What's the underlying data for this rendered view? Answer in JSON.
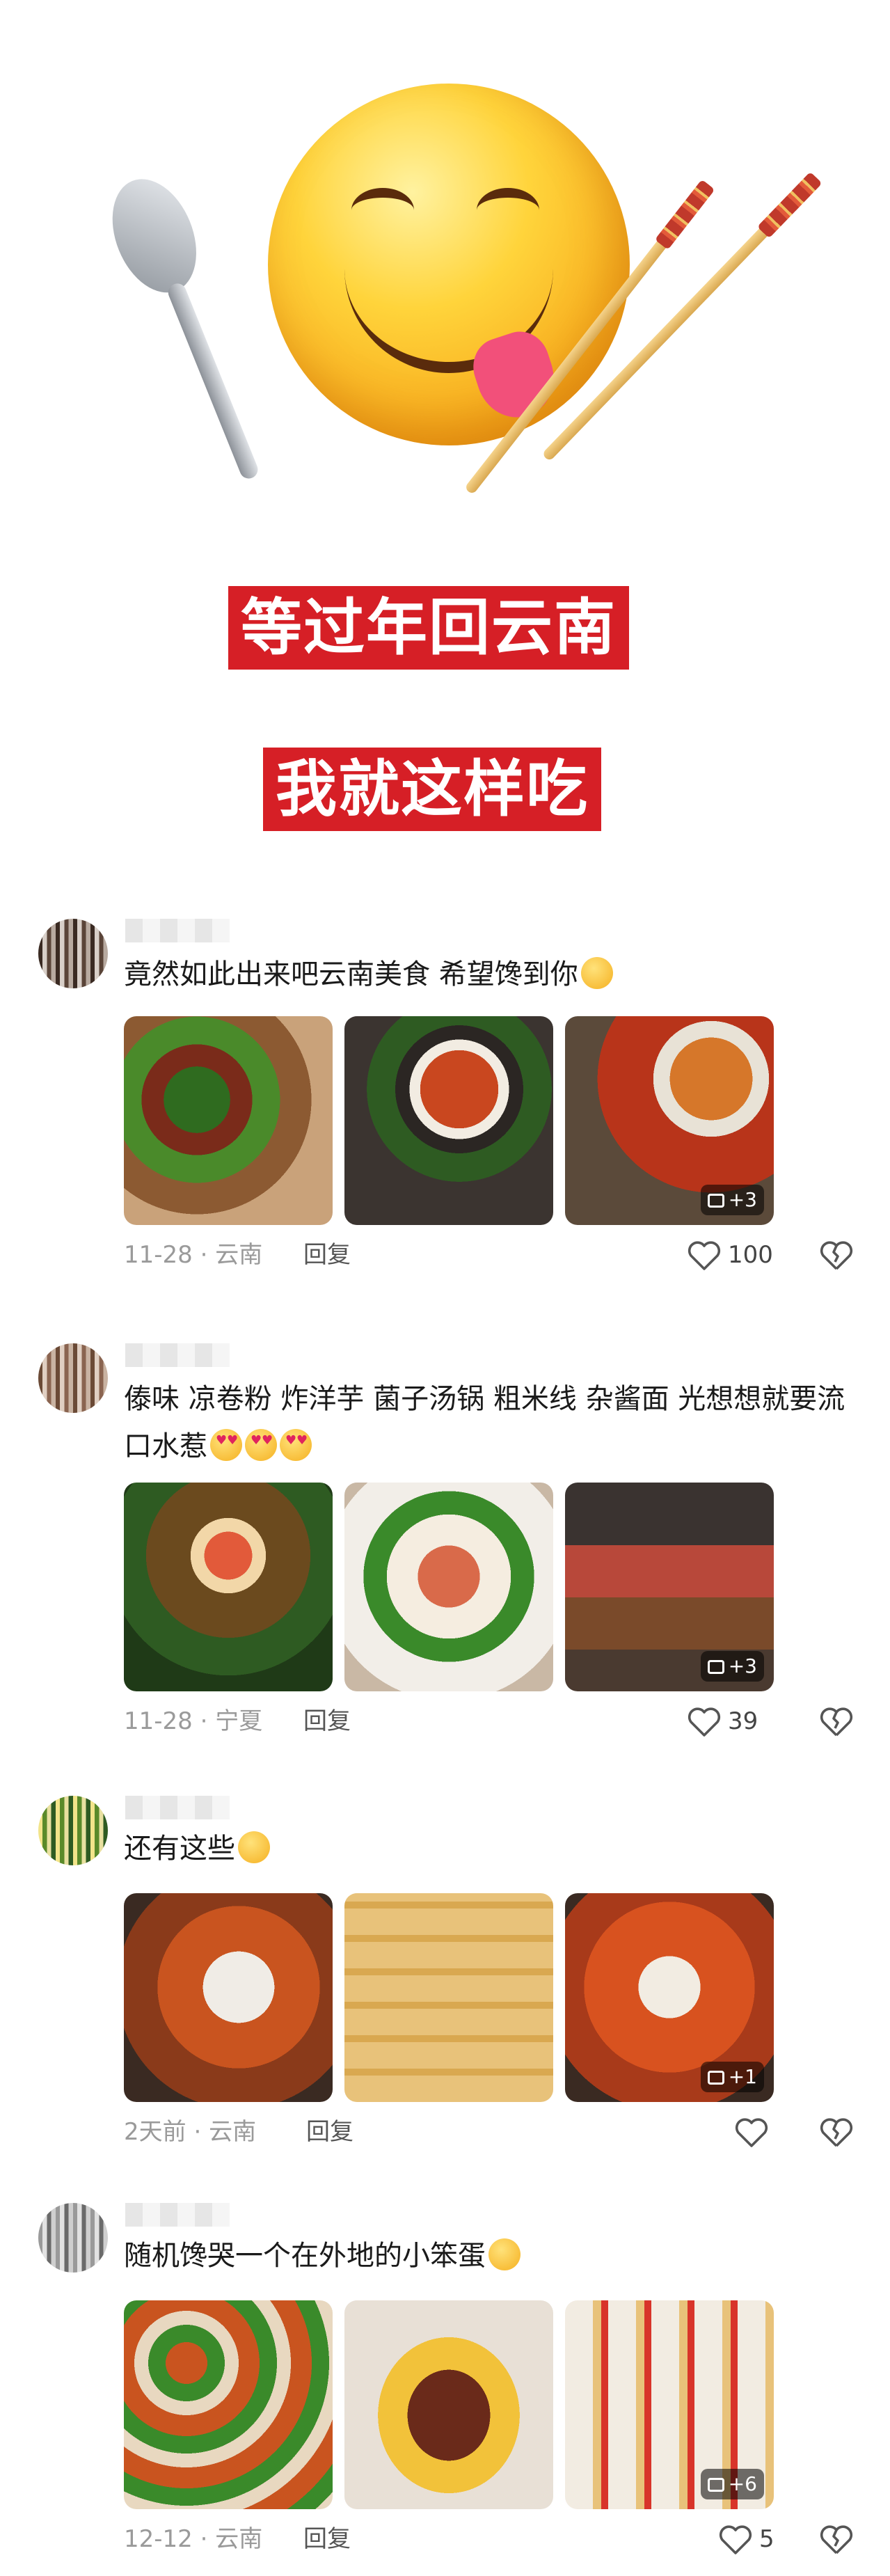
{
  "banner": {
    "line1": "等过年回云南",
    "line2": "我就这样吃"
  },
  "comments": [
    {
      "text": "竟然如此出来吧云南美食 希望馋到你",
      "emoji": "drooling-face-emoji",
      "time": "11-28",
      "location": "云南",
      "reply_label": "回复",
      "likes": "100",
      "more_photos": "+3"
    },
    {
      "text": "傣味 凉卷粉 炸洋芋 菌子汤锅 粗米线 杂酱面 光想想就要流口水惹",
      "emoji": "heart-eyes-emoji",
      "time": "11-28",
      "location": "宁夏",
      "reply_label": "回复",
      "likes": "39",
      "more_photos": "+3"
    },
    {
      "text": "还有这些",
      "emoji": "grinning-face-emoji",
      "time": "2天前",
      "location": "云南",
      "reply_label": "回复",
      "likes": "",
      "more_photos": "+1"
    },
    {
      "text": "随机馋哭一个在外地的小笨蛋",
      "emoji": "crying-face-emoji",
      "time": "12-12",
      "location": "云南",
      "reply_label": "回复",
      "likes": "5",
      "more_photos": "+6"
    }
  ],
  "meta_separator": "·",
  "colors": {
    "banner_red": "#d61f26",
    "meta_gray": "#9a9a9a"
  }
}
